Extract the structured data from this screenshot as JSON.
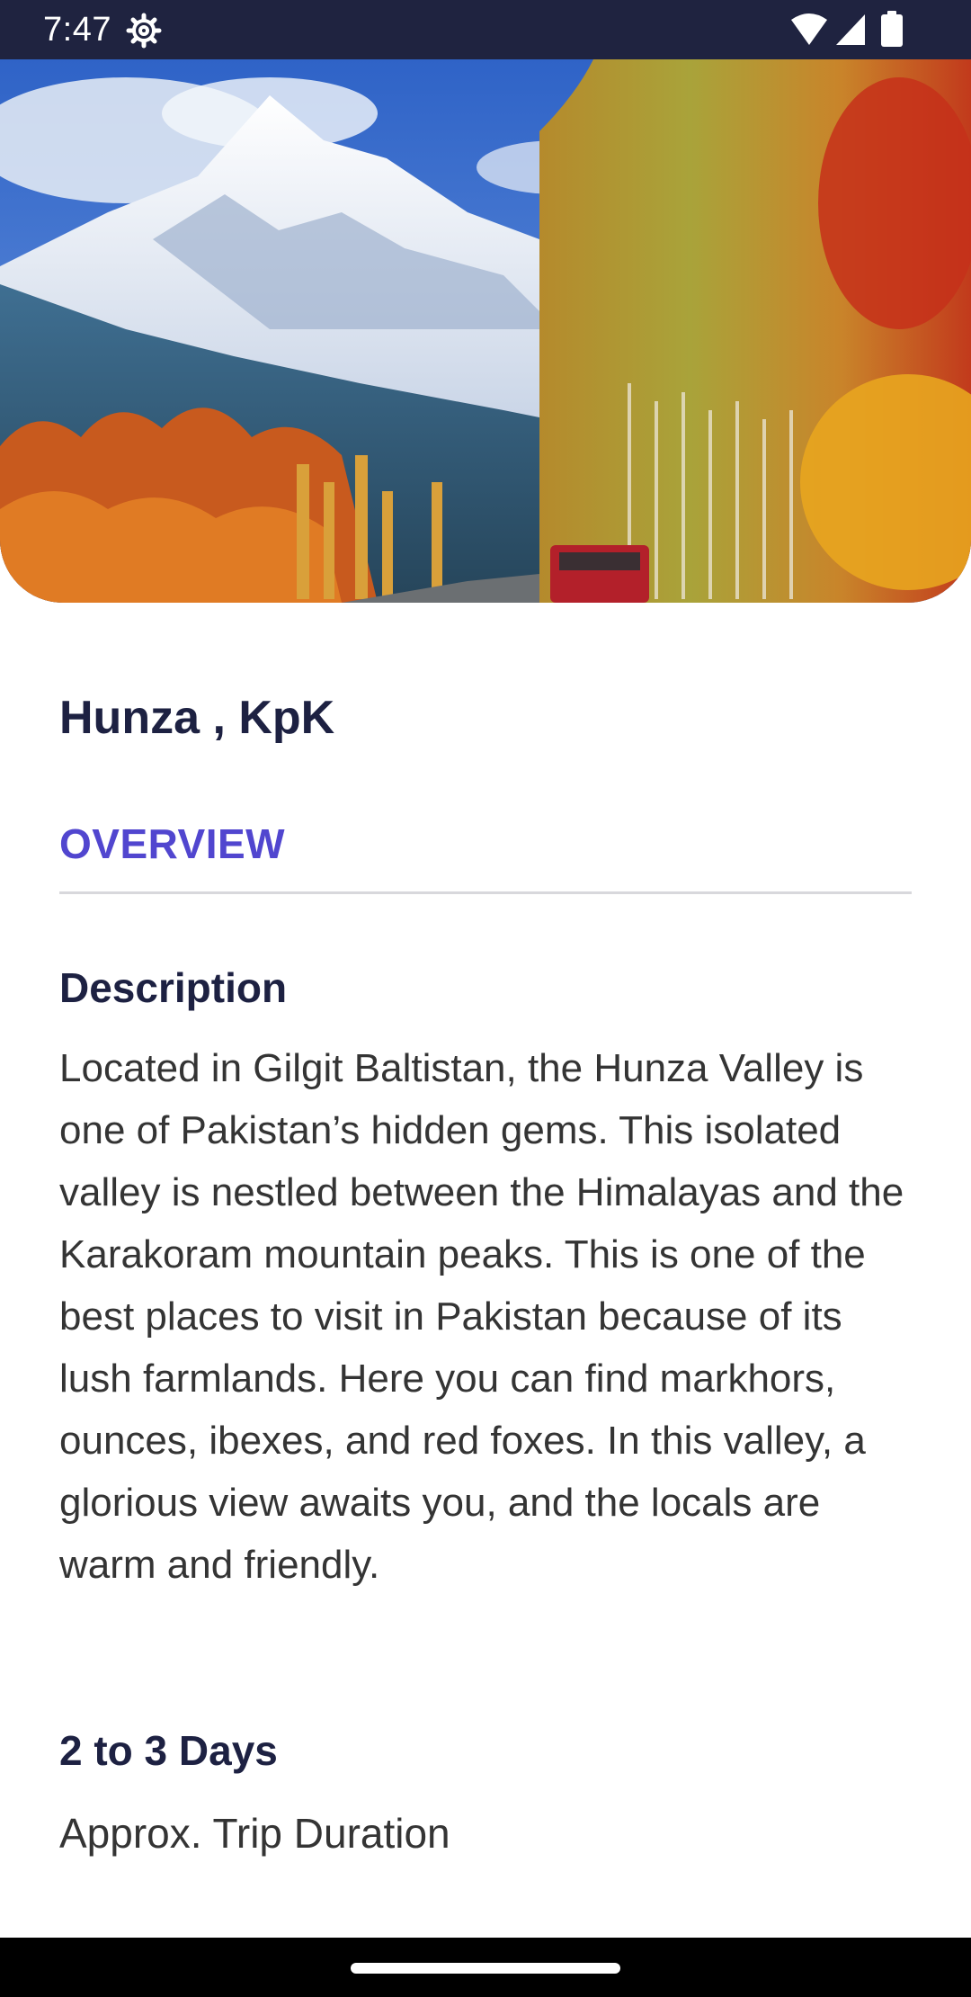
{
  "status_bar": {
    "time": "7:47",
    "icons": [
      "gear-icon",
      "wifi-icon",
      "signal-icon",
      "battery-icon"
    ]
  },
  "hero": {
    "image": "mountain-valley-autumn-trees-photo"
  },
  "place": {
    "title": "Hunza , KpK"
  },
  "tabs": {
    "overview_label": "OVERVIEW"
  },
  "description": {
    "heading": "Description",
    "body": "Located in Gilgit Baltistan, the Hunza Valley is one of Pakistan’s hidden gems. This isolated valley is nestled between the Himalayas and the Karakoram mountain peaks. This is one of the best places to visit in Pakistan because of its lush farmlands. Here you can find markhors, ounces, ibexes, and red foxes. In this valley, a glorious view awaits you, and the locals are warm and friendly."
  },
  "trip": {
    "duration_value": "2 to 3 Days",
    "duration_label": "Approx. Trip Duration"
  },
  "colors": {
    "status_bar": "#1f2340",
    "accent": "#5146cf",
    "heading": "#1d2142",
    "body_text": "#343434"
  }
}
